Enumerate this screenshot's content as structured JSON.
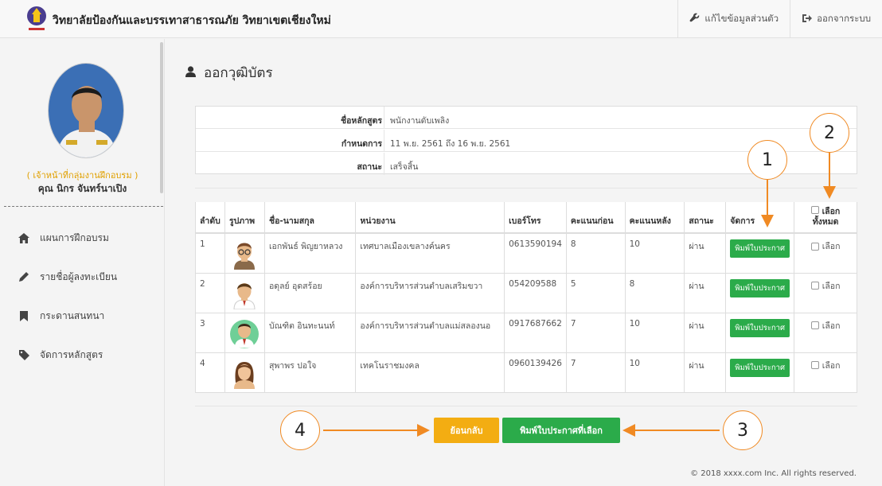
{
  "header": {
    "brand": "วิทยาลัยป้องกันและบรรเทาสาธารณภัย วิทยาเขตเชียงใหม่",
    "nav": [
      "แก้ไขข้อมูลส่วนตัว",
      "ออกจากระบบ"
    ]
  },
  "sidebar": {
    "role": "( เจ้าหน้าที่กลุ่มงานฝึกอบรม )",
    "name": "คุณ นิกร จันทร์นาเปิง",
    "menu": [
      "แผนการฝึกอบรม",
      "รายชื่อผู้ลงทะเบียน",
      "กระดานสนทนา",
      "จัดการหลักสูตร"
    ]
  },
  "page": {
    "title": "ออกวุฒิบัตร"
  },
  "info": {
    "course_label": "ชื่อหลักสูตร",
    "course_value": "พนักงานดับเพลิง",
    "schedule_label": "กำหนดการ",
    "schedule_value": "11 พ.ย. 2561 ถึง 16 พ.ย. 2561",
    "status_label": "สถานะ",
    "status_value": "เสร็จสิ้น"
  },
  "table": {
    "headers": [
      "ลำดับ",
      "รูปภาพ",
      "ชื่อ-นามสกุล",
      "หน่วยงาน",
      "เบอร์โทร",
      "คะแนนก่อน",
      "คะแนนหลัง",
      "สถานะ",
      "จัดการ"
    ],
    "select_all": [
      "เลือก",
      "ทั้งหมด"
    ],
    "print_label": "พิมพ์ใบประกาศ",
    "select_label": "เลือก",
    "rows": [
      {
        "no": "1",
        "name": "เอกพันธ์ พิญยาหลวง",
        "org": "เทศบาลเมืองเขลางค์นคร",
        "phone": "0613590194",
        "pre": "8",
        "post": "10",
        "status": "ผ่าน"
      },
      {
        "no": "2",
        "name": "อดุลย์ อุดสร้อย",
        "org": "องค์การบริหารส่วนตำบลเสริมขวา",
        "phone": "054209588",
        "pre": "5",
        "post": "8",
        "status": "ผ่าน"
      },
      {
        "no": "3",
        "name": "บัณฑิต อินทะนนท์",
        "org": "องค์การบริหารส่วนตำบลแม่สลองนอ",
        "phone": "0917687662",
        "pre": "7",
        "post": "10",
        "status": "ผ่าน"
      },
      {
        "no": "4",
        "name": "สุพาพร ปอใจ",
        "org": "เทคโนราชมงคล",
        "phone": "0960139426",
        "pre": "7",
        "post": "10",
        "status": "ผ่าน"
      }
    ]
  },
  "actions": {
    "back": "ย้อนกลับ",
    "print_selected": "พิมพ์ใบประกาศที่เลือก"
  },
  "footer": "© 2018 xxxx.com Inc. All rights reserved.",
  "callouts": [
    "1",
    "2",
    "3",
    "4"
  ],
  "colors": {
    "green": "#2bab4a",
    "orange": "#f3ad12",
    "callout": "#f08a23"
  }
}
